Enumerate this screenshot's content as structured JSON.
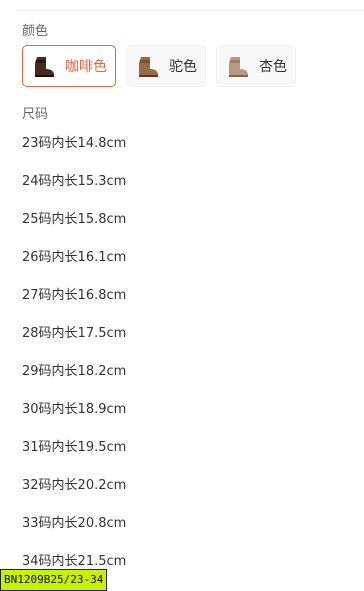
{
  "color_section": {
    "title": "颜色",
    "options": [
      {
        "label": "咖啡色",
        "selected": true,
        "icon": "boot-thumbnail-coffee",
        "color": "#4a2a1c"
      },
      {
        "label": "驼色",
        "selected": false,
        "icon": "boot-thumbnail-camel",
        "color": "#9a6a45"
      },
      {
        "label": "杏色",
        "selected": false,
        "icon": "boot-thumbnail-apricot",
        "color": "#b79a80"
      }
    ]
  },
  "size_section": {
    "title": "尺码",
    "items": [
      "23码内长14.8cm",
      "24码内长15.3cm",
      "25码内长15.8cm",
      "26码内长16.1cm",
      "27码内长16.8cm",
      "28码内长17.5cm",
      "29码内长18.2cm",
      "30码内长18.9cm",
      "31码内长19.5cm",
      "32码内长20.2cm",
      "33码内长20.8cm",
      "34码内长21.5cm"
    ]
  },
  "sku_tag": "BN1209B25/23-34",
  "accent_color": "#e8643c"
}
